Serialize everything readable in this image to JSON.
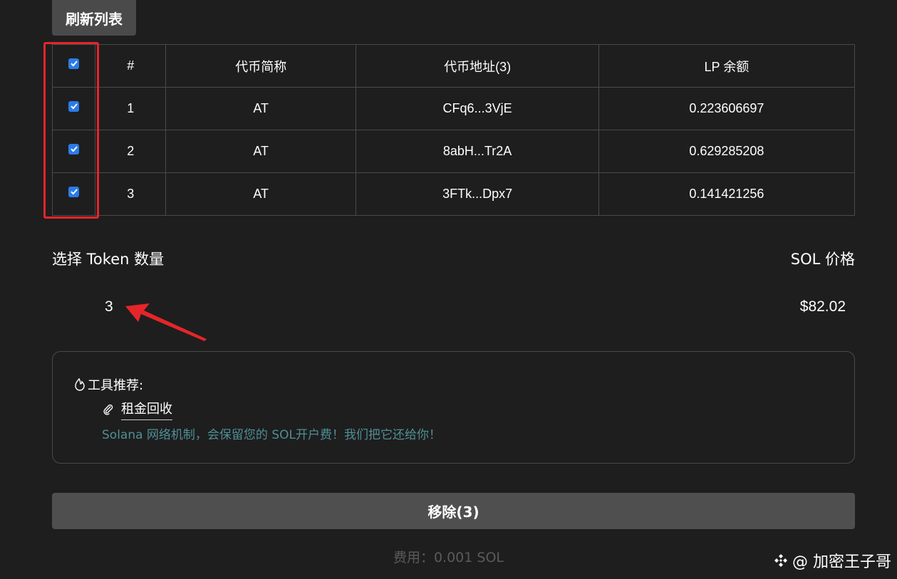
{
  "refresh_label": "刷新列表",
  "table": {
    "headers": [
      "#",
      "代币简称",
      "代币地址(3)",
      "LP 余额"
    ],
    "rows": [
      {
        "num": "1",
        "symbol": "AT",
        "address": "CFq6...3VjE",
        "lp": "0.223606697"
      },
      {
        "num": "2",
        "symbol": "AT",
        "address": "8abH...Tr2A",
        "lp": "0.629285208"
      },
      {
        "num": "3",
        "symbol": "AT",
        "address": "3FTk...Dpx7",
        "lp": "0.141421256"
      }
    ]
  },
  "select_label": "选择 Token 数量",
  "selected_count": "3",
  "sol_price_label": "SOL 价格",
  "sol_price": "$82.02",
  "tools": {
    "title": "工具推荐:",
    "link_label": "租金回收",
    "description": "Solana 网络机制，会保留您的 SOL开户费！我们把它还给你！"
  },
  "remove_label": "移除(3)",
  "fee_text": "费用：0.001 SOL",
  "watermark": "@ 加密王子哥",
  "colors": {
    "background": "#1e1e1e",
    "checkbox": "#2b7be8",
    "highlight": "#e5252a",
    "link_desc": "#4f8f96"
  }
}
